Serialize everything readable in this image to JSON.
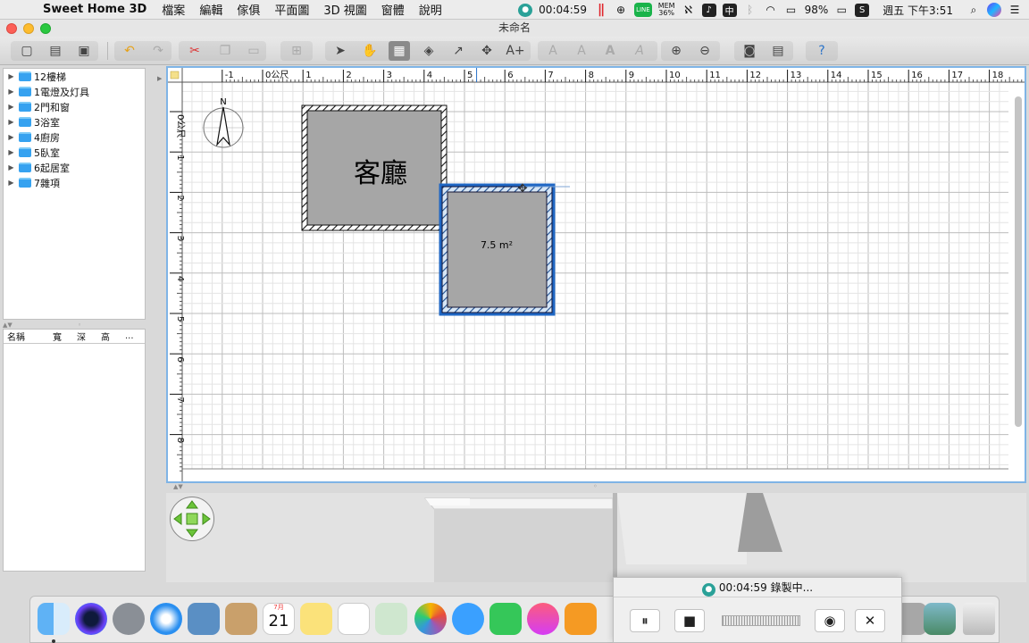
{
  "menubar": {
    "apple_glyph": "",
    "app_name": "Sweet Home 3D",
    "menus": [
      "檔案",
      "編輯",
      "傢俱",
      "平面圖",
      "3D 視圖",
      "窗體",
      "說明"
    ],
    "rec_time": "00:04:59",
    "pause_glyph": "||",
    "line_label": "LINE",
    "mem_label": "MEM",
    "mem_value": "36%",
    "battery": "98%",
    "datetime": "週五 下午3:51"
  },
  "window": {
    "title": "未命名"
  },
  "catalog": {
    "items": [
      {
        "label": "12樓梯"
      },
      {
        "label": "1電燈及灯具"
      },
      {
        "label": "2門和窗"
      },
      {
        "label": "3浴室"
      },
      {
        "label": "4廚房"
      },
      {
        "label": "5臥室"
      },
      {
        "label": "6起居室"
      },
      {
        "label": "7雜項"
      }
    ]
  },
  "furniture_table": {
    "columns": [
      "名稱",
      "寬",
      "深",
      "高",
      "..."
    ]
  },
  "plan": {
    "ruler_x": [
      "-2",
      "-1",
      "0公尺",
      "1",
      "2",
      "3",
      "4",
      "5",
      "6",
      "7",
      "8",
      "9",
      "10",
      "11",
      "12",
      "13",
      "14",
      "15",
      "16",
      "17",
      "18"
    ],
    "ruler_y": [
      "0公尺",
      "1",
      "2",
      "3",
      "4",
      "5",
      "6",
      "7",
      "8"
    ],
    "compass_label": "N",
    "rooms": [
      {
        "name": "客廳",
        "area": ""
      },
      {
        "name": "",
        "area": "7.5 m²"
      }
    ]
  },
  "recorder": {
    "title": "00:04:59 錄製中...",
    "pause_glyph": "⏸",
    "stop_glyph": "■",
    "close_glyph": "✕"
  },
  "dock": {
    "calendar_month": "7月",
    "calendar_day": "21"
  },
  "colors": {
    "selection": "#1f67c4",
    "room_fill": "#a6a6a6",
    "grid_major": "#bdbdbd",
    "grid_minor": "#e4e4e4"
  }
}
